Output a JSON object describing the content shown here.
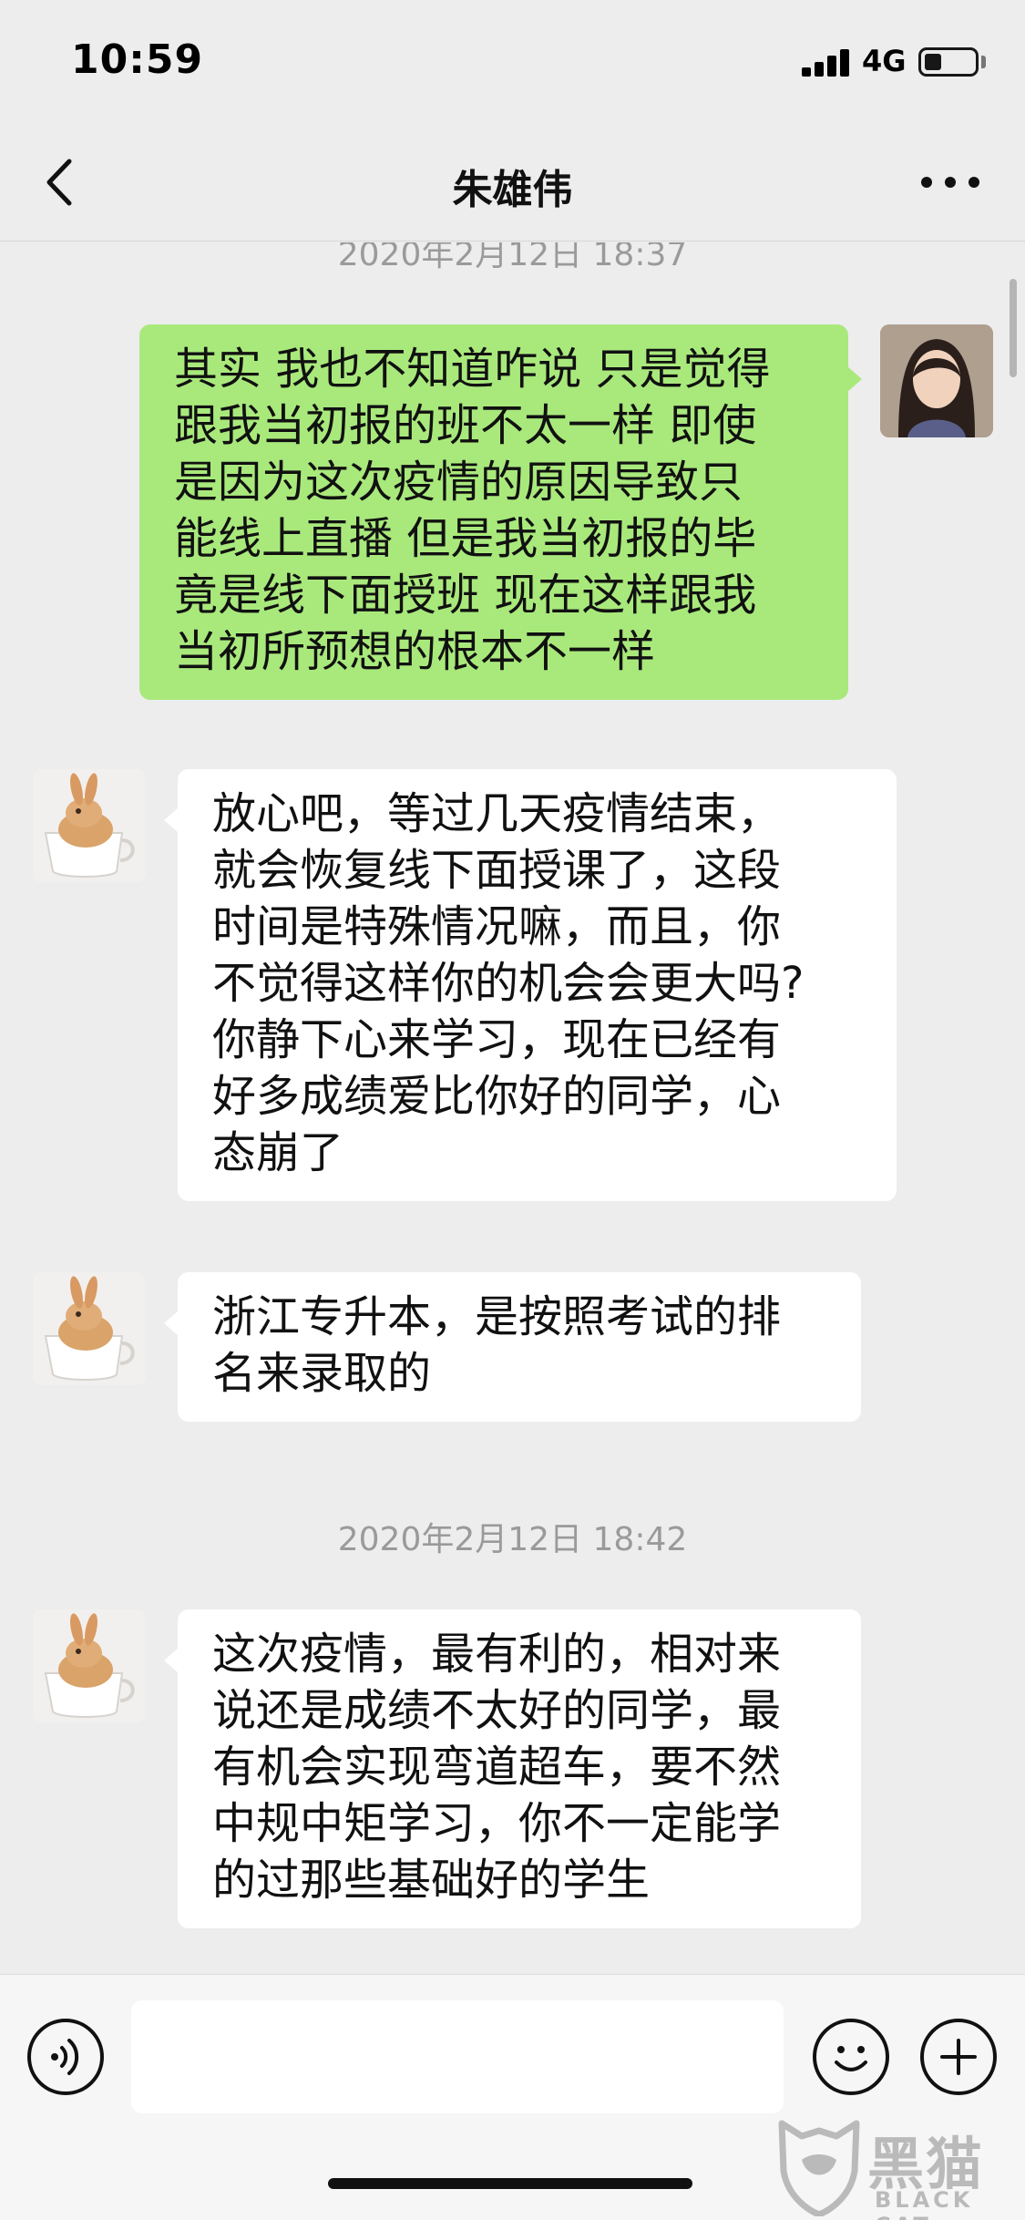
{
  "status_bar": {
    "time": "10:59",
    "network": "4G"
  },
  "header": {
    "title": "朱雄伟"
  },
  "chat": {
    "timestamps": [
      "2020年2月12日 18:37",
      "2020年2月12日 18:42"
    ],
    "messages": [
      {
        "sender": "self",
        "lines": [
          "其实 我也不知道咋说 只是觉得",
          "跟我当初报的班不太一样 即使",
          "是因为这次疫情的原因导致只",
          "能线上直播 但是我当初报的毕",
          "竟是线下面授班 现在这样跟我",
          "当初所预想的根本不一样"
        ]
      },
      {
        "sender": "other",
        "lines": [
          "放心吧，等过几天疫情结束，",
          "就会恢复线下面授课了，这段",
          "时间是特殊情况嘛，而且，你",
          "不觉得这样你的机会会更大吗?",
          "你静下心来学习，现在已经有",
          "好多成绩爱比你好的同学，心",
          "态崩了"
        ]
      },
      {
        "sender": "other",
        "lines": [
          "浙江专升本，是按照考试的排",
          "名来录取的"
        ]
      },
      {
        "sender": "other",
        "lines": [
          "这次疫情，最有利的，相对来",
          "说还是成绩不太好的同学，最",
          "有机会实现弯道超车，要不然",
          "中规中矩学习，你不一定能学",
          "的过那些基础好的学生"
        ]
      }
    ]
  },
  "input_bar": {
    "value": ""
  },
  "watermark": {
    "cn": "黑猫",
    "en": "BLACK CAT"
  },
  "colors": {
    "background": "#ededed",
    "sent_bubble": "#a9e97c",
    "received_bubble": "#ffffff",
    "timestamp_text": "#9a9a9a"
  },
  "icons": {
    "back": "chevron-left-icon",
    "more": "more-dots-icon",
    "voice": "voice-icon",
    "emoji": "emoji-icon",
    "plus": "plus-icon"
  }
}
